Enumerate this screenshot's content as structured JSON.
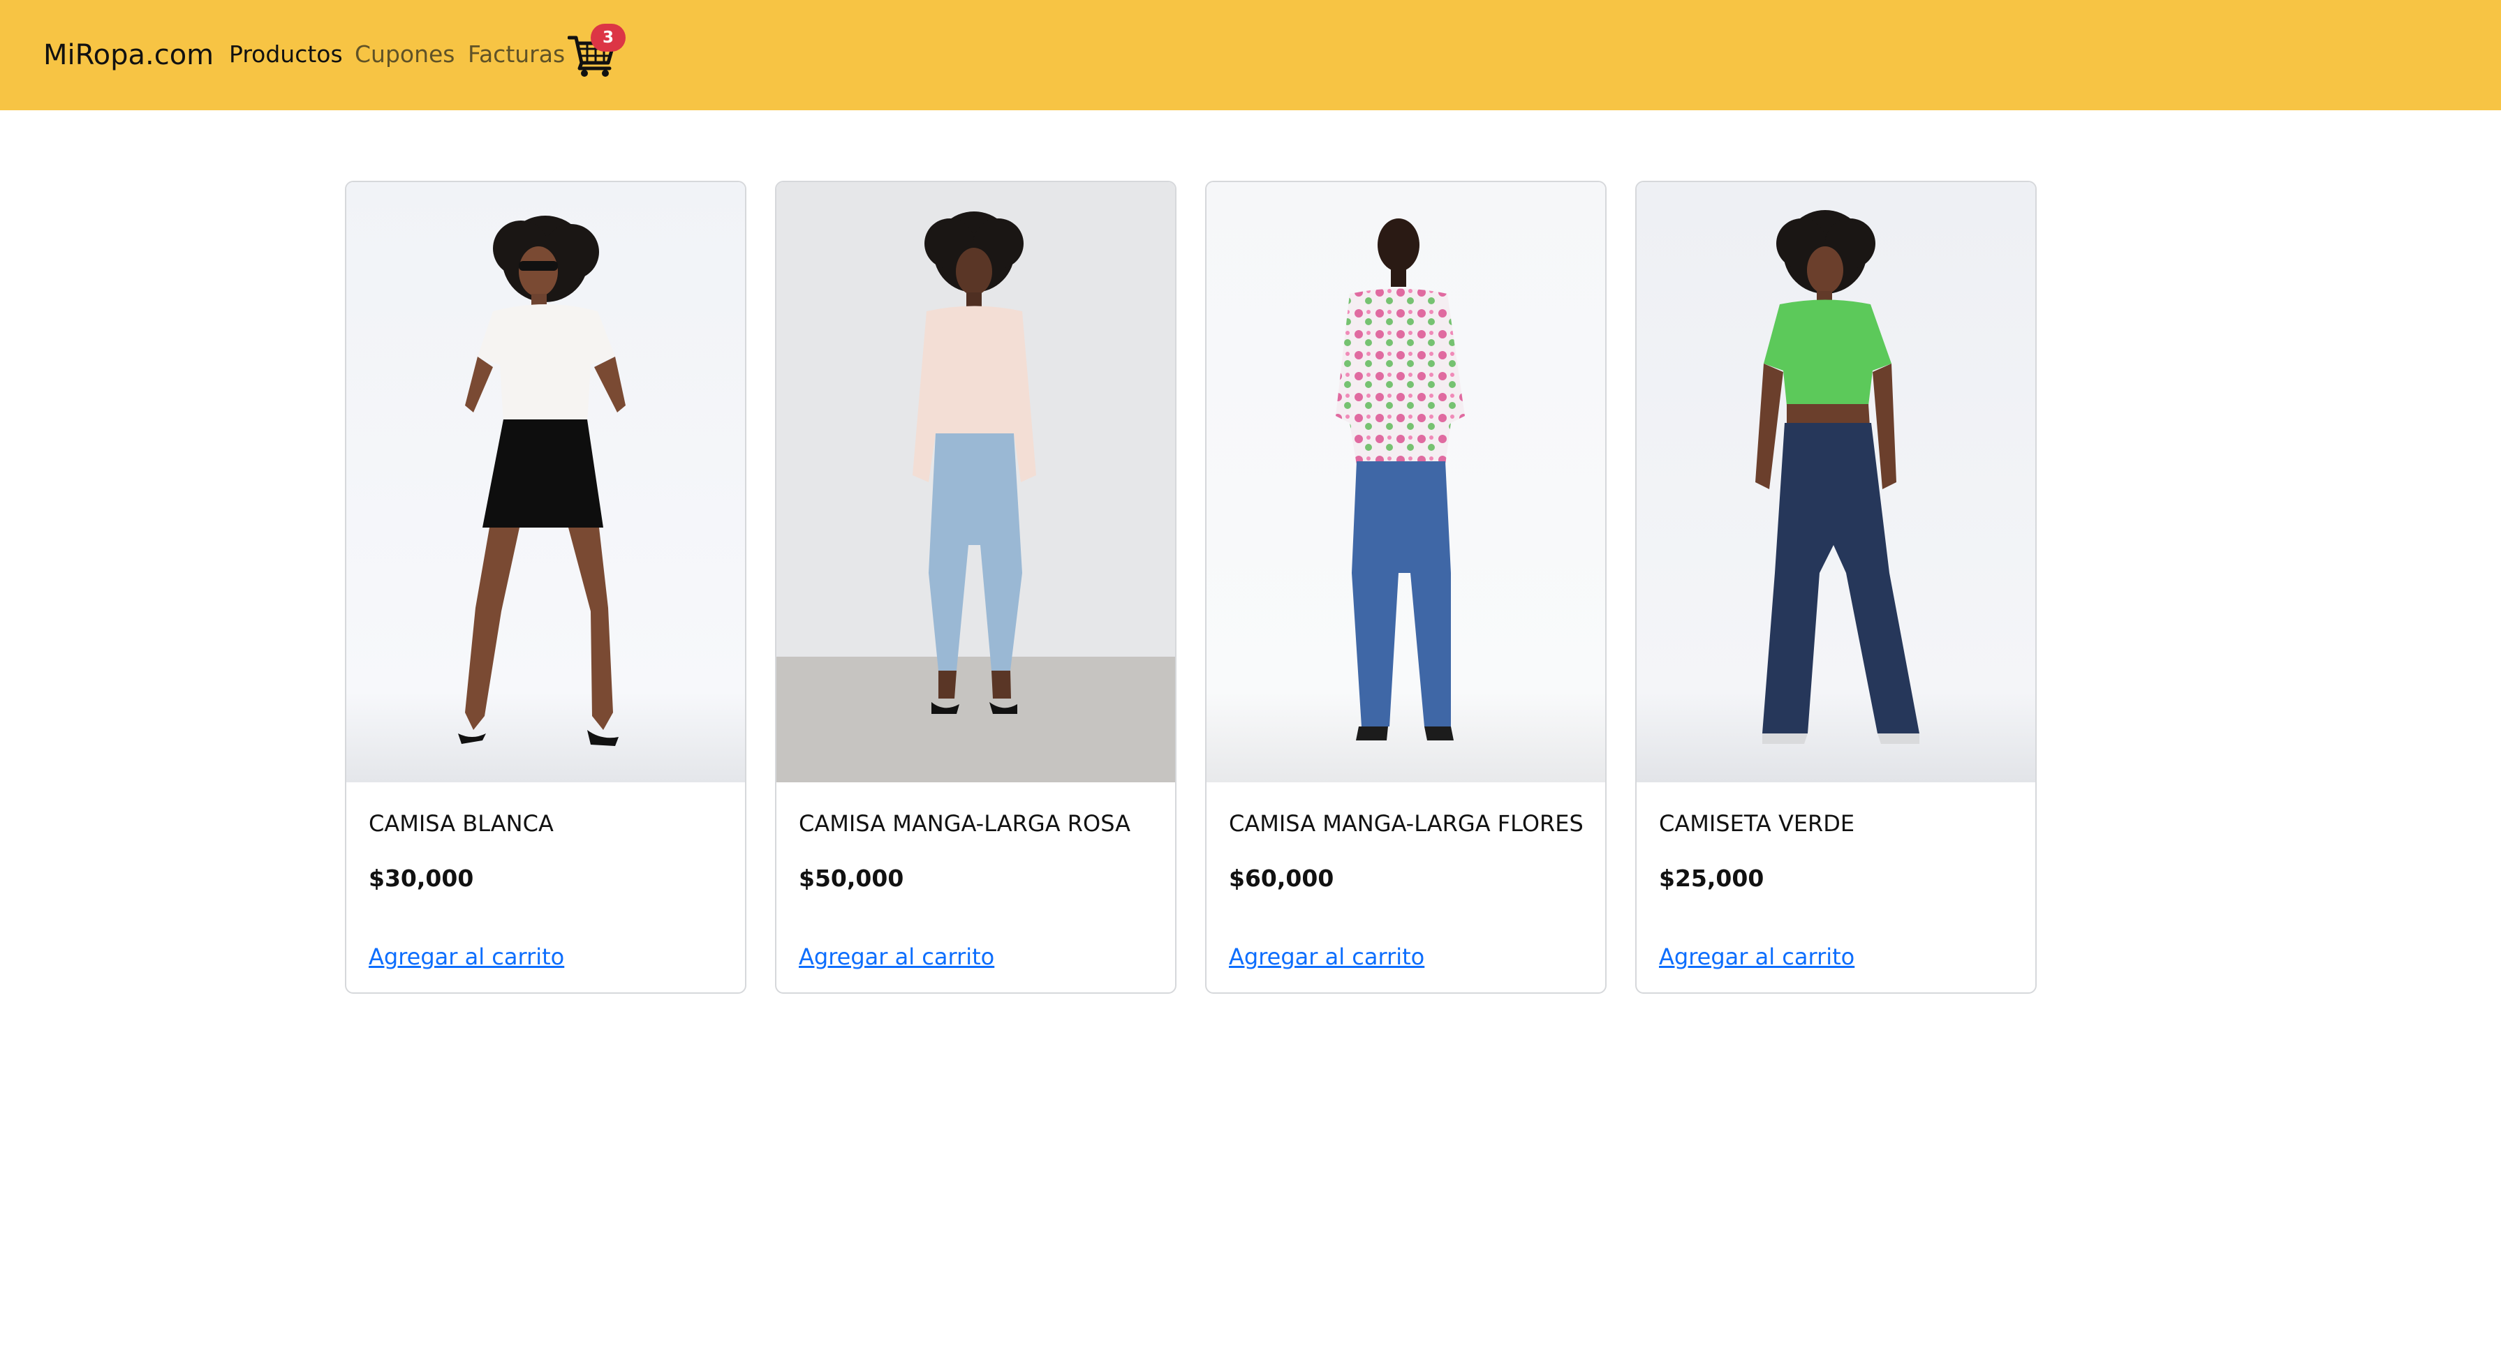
{
  "navbar": {
    "brand": "MiRopa.com",
    "links": [
      {
        "label": "Productos",
        "active": true
      },
      {
        "label": "Cupones",
        "active": false
      },
      {
        "label": "Facturas",
        "active": false
      }
    ],
    "cart": {
      "icon": "shopping-cart-icon",
      "count": "3"
    },
    "colors": {
      "background": "#f7c444",
      "badge": "#dc3545"
    }
  },
  "products": [
    {
      "name": "CAMISA BLANCA",
      "price": "$30,000",
      "action": "Agregar al carrito",
      "image": "model-white-top-black-skirt"
    },
    {
      "name": "CAMISA MANGA-LARGA ROSA",
      "price": "$50,000",
      "action": "Agregar al carrito",
      "image": "model-pink-blouse-light-jeans"
    },
    {
      "name": "CAMISA MANGA-LARGA FLORES",
      "price": "$60,000",
      "action": "Agregar al carrito",
      "image": "model-floral-shirt-blue-jeans"
    },
    {
      "name": "CAMISETA VERDE",
      "price": "$25,000",
      "action": "Agregar al carrito",
      "image": "model-green-polo-dark-jeans"
    }
  ],
  "colors": {
    "link": "#0d6efd",
    "card_border": "#d6d8db"
  }
}
